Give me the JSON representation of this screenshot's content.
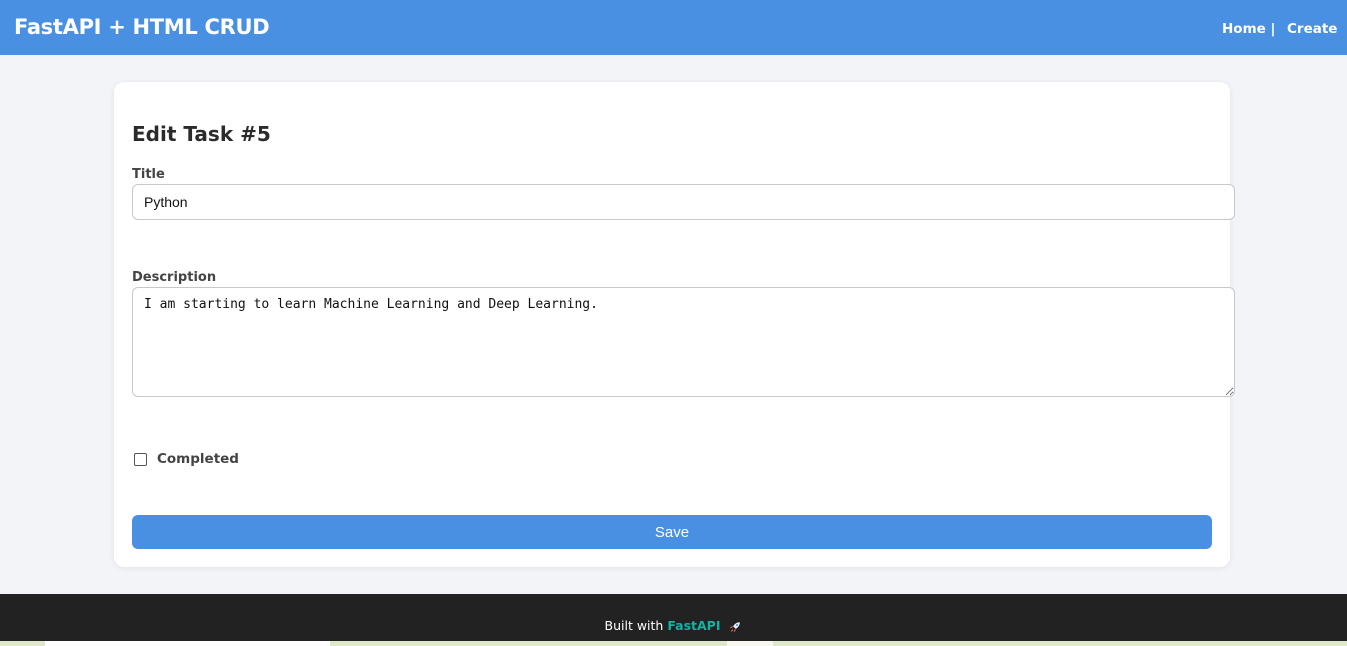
{
  "header": {
    "brand": "FastAPI + HTML CRUD",
    "nav": {
      "home": "Home |",
      "create": "Create"
    }
  },
  "form": {
    "heading": "Edit Task #5",
    "title_label": "Title",
    "title_value": "Python",
    "description_label": "Description",
    "description_value": "I am starting to learn Machine Learning and Deep Learning.",
    "completed_label": "Completed",
    "completed_checked": false,
    "save_label": "Save"
  },
  "footer": {
    "prefix": "Built with",
    "brand": "FastAPI",
    "icon": "rocket-icon"
  },
  "colors": {
    "accent": "#4a90e2",
    "footer_bg": "#222222",
    "footer_brand": "#17b0a5",
    "page_bg": "#f2f4f8"
  }
}
